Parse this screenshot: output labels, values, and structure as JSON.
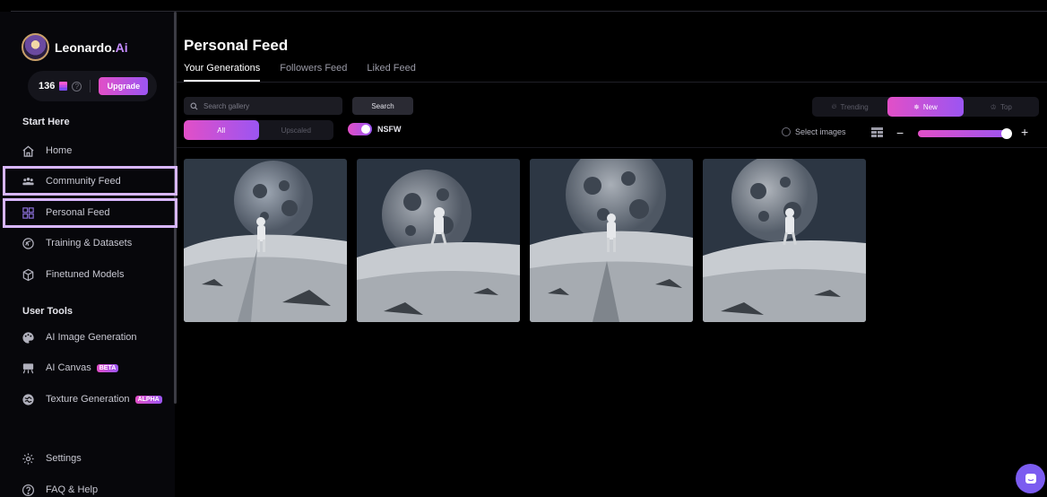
{
  "brand": {
    "name": "Leonardo.",
    "suffix": "Ai"
  },
  "credits": {
    "count": "136",
    "upgrade_label": "Upgrade"
  },
  "sidebar": {
    "start_here_label": "Start Here",
    "start_items": [
      {
        "label": "Home",
        "icon": "home-icon"
      },
      {
        "label": "Community Feed",
        "icon": "community-icon"
      },
      {
        "label": "Personal Feed",
        "icon": "grid-icon"
      },
      {
        "label": "Training & Datasets",
        "icon": "training-icon"
      },
      {
        "label": "Finetuned Models",
        "icon": "cube-icon"
      }
    ],
    "user_tools_label": "User Tools",
    "tool_items": [
      {
        "label": "AI Image Generation",
        "icon": "palette-icon",
        "badge": ""
      },
      {
        "label": "AI Canvas",
        "icon": "easel-icon",
        "badge": "BETA"
      },
      {
        "label": "Texture Generation",
        "icon": "texture-icon",
        "badge": "ALPHA"
      }
    ],
    "bottom_items": [
      {
        "label": "Settings",
        "icon": "gear-icon"
      },
      {
        "label": "FAQ & Help",
        "icon": "question-icon"
      }
    ]
  },
  "main": {
    "title": "Personal Feed",
    "tabs": [
      {
        "label": "Your Generations",
        "active": true
      },
      {
        "label": "Followers Feed",
        "active": false
      },
      {
        "label": "Liked Feed",
        "active": false
      }
    ],
    "search": {
      "placeholder": "Search gallery",
      "button_label": "Search"
    },
    "filter": {
      "all_label": "All",
      "upscaled_label": "Upscaled"
    },
    "nsfw_label": "NSFW",
    "sort": [
      {
        "label": "Trending",
        "active": false
      },
      {
        "label": "New",
        "active": true
      },
      {
        "label": "Top",
        "active": false
      }
    ],
    "select_images_label": "Select images",
    "gallery": [
      {
        "alt": "astronaut-on-moon-1"
      },
      {
        "alt": "astronaut-on-moon-2"
      },
      {
        "alt": "astronaut-on-moon-3"
      },
      {
        "alt": "astronaut-on-moon-4"
      }
    ]
  },
  "colors": {
    "accent_start": "#e24fc7",
    "accent_end": "#9b55f2",
    "highlight": "#d8b6ff",
    "chat": "#7b5cf0"
  }
}
